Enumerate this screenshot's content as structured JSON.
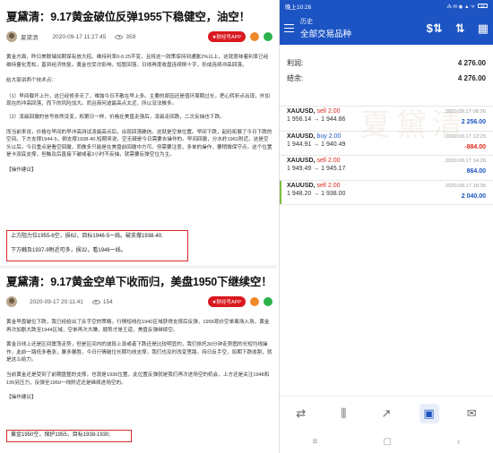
{
  "article1": {
    "title": "夏黛清：9.17黄金破位反弹1955下稳健空，油空！",
    "author": "夏黛清",
    "date": "2020-09-17 11:27:45",
    "views": "359",
    "app_button": "★财经号APP",
    "para1": "黄金方面，昨日美联储如期保有放大招，维持利率0-0.25不变，且将这一政策保持到通胀2%以上，这就意味着利率已经维持量化宽松，直到经济恢复。黄金也受次影响，短暂回落，日线再度收盘连续倒十字，形成连续冲高回落。",
    "para2": "给大家讲两个技术点：",
    "para3": "（1）早间载坏上升，这已经修多天了，难独今日不散在早上多。主要的原因还是值环周期过长，把心转折点出现，外加现在的冲高回落，而下的风险加大。而且商何波最高点太近，所以没法推多。",
    "para4": "（2）凌晨回撤的信号依然没变，和第日一样，价格在美盘走强后，凌晨走回跌，二次反抽也下跌。",
    "para5": "而当前来说，价格在早间的早冲高测试凌晨高点后，出现回落确信。这就是空单位置。早间下跌，起码拓展了今日下跌的空间。下方支撑1944-5，倒支撑1938-40.短期来说，空无疑是今日需要去操作的。早间回撤，分水岭1961附近。这是空头以后，今日重点是看空回撤，而做多只能是在美盘前回撤中方可。但需要注意，多单的操作，要稍微保守点，这个位置是卡双底支撑，但触及后直接下破或者2小时不反抽，就需要反弹空位为主。",
    "label": "【操作建议】",
    "suggest1": "上方阻力位1955-6空，损62，目标1946-5一线。破支撑1938-40.",
    "suggest2": "下方触及1937-9附近可多，损32，看1946一线。"
  },
  "article2": {
    "title": "夏黛清：9.17黄金空单下收而归，美盘1950下继续空！",
    "date": "2020-09-17 20:11:41",
    "views": "154",
    "app_button": "★财经号APP",
    "para1": "黄金早盘破位下跌，我已经给出了反手空的策略，行情短线在1940区域获得支撑后反弹，1956观价空单离场入场，黄金再次加剧大跌至1944区域，空单再次大赚，顺势才是王道，美盘反弹继续空。",
    "para2": "黄金日线上还是区间震荡走势，但是区间内的波段上涨或者下跌还是比较明显的，我们依托30分钟走势图的长短均线操作，此前一路低多看涨，屡多屡胜，今日行情破位长期均线支撑，我们也及时改变思路，持日反手空，如期下跌收割，就是这么给力。",
    "para3": "当前黄金还是受到了前期盘整的支撑，也就是1936位置，此位置反弹就是我们再次进场空的机会，上方还是关注1948和195另压力，反弹至1950一线附近还是继续进场空的。",
    "label": "【操作建议】",
    "suggest1": "黄金1950空，保护1955，目标1938-1930;"
  },
  "phone": {
    "status_time": "晚上10:26",
    "status_icons": "⁂ ✉ ◉ ▲ ᯤ",
    "battery": "45",
    "header_sub": "历史",
    "header_title": "全部交易品种",
    "profit_label": "利润:",
    "profit_value": "4 276.00",
    "balance_label": "结余:",
    "balance_value": "4 276.00",
    "orders": [
      {
        "symbol": "XAUUSD,",
        "side": "sell",
        "lots": "2.00",
        "prices": "1 956.14 → 1 944.86",
        "datetime": "2020.09.17 08:26",
        "pl": "2 256.00"
      },
      {
        "symbol": "XAUUSD,",
        "side": "buy",
        "lots": "2.00",
        "prices": "1 944.91 → 1 940.49",
        "datetime": "2020.09.17 12:25",
        "pl": "-884.00"
      },
      {
        "symbol": "XAUUSD,",
        "side": "sell",
        "lots": "2.00",
        "prices": "1 949.49 → 1 945.17",
        "datetime": "2020.09.17 14:26",
        "pl": "864.00"
      },
      {
        "symbol": "XAUUSD,",
        "side": "sell",
        "lots": "2.00",
        "prices": "1 948.20 → 1 938.00",
        "datetime": "2020.09.17 16:05",
        "pl": "2 040.00"
      }
    ],
    "watermark": "夏黛清"
  }
}
